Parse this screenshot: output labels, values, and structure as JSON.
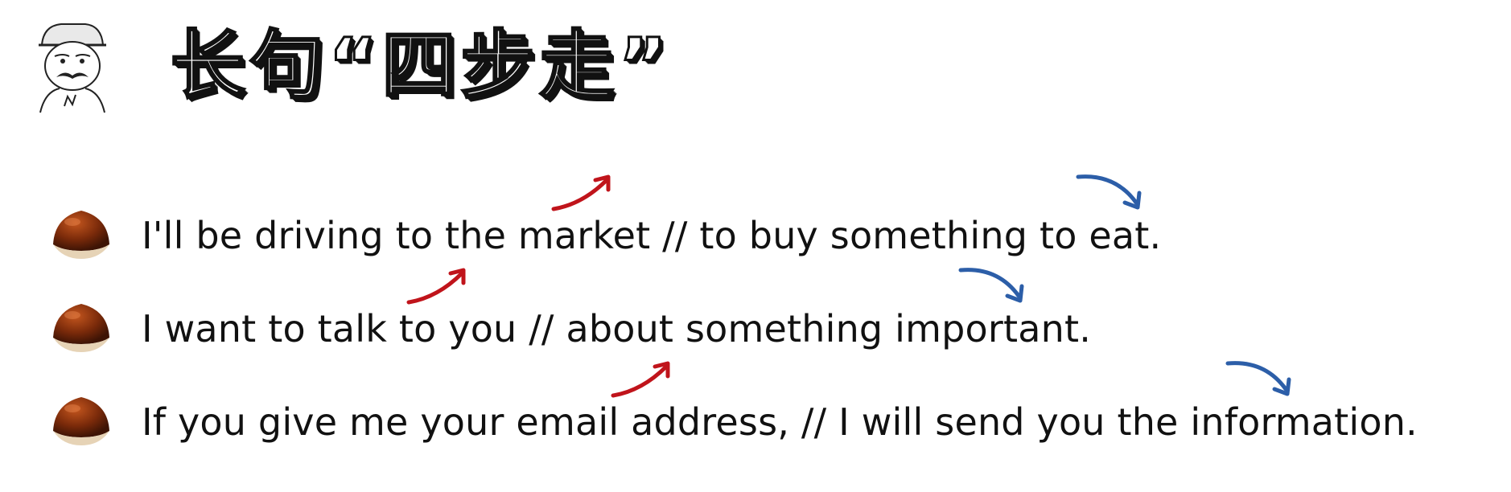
{
  "title": "长句“四步走”",
  "mascot_icon": "mustached-man-with-hat-icon",
  "bullet_icon": "chestnut-icon",
  "sentences": [
    "I'll be driving to the market // to buy something to eat.",
    "I want to talk to you // about something important.",
    "If you give me your email address, // I will send you the information."
  ],
  "colors": {
    "rising_arrow": "#C0141B",
    "falling_arrow": "#2C5EA8",
    "text": "#111111"
  }
}
